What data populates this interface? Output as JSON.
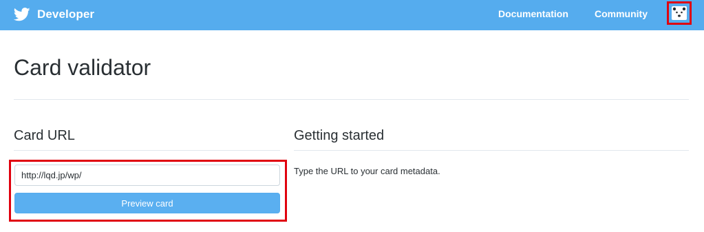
{
  "header": {
    "brand_label": "Developer",
    "brand_icon": "twitter-bird-icon",
    "nav": [
      {
        "label": "Documentation"
      },
      {
        "label": "Community"
      }
    ],
    "avatar_icon": "bear-face-icon"
  },
  "page": {
    "title": "Card validator"
  },
  "card_url": {
    "heading": "Card URL",
    "input_value": "http://lqd.jp/wp/",
    "button_label": "Preview card"
  },
  "getting_started": {
    "heading": "Getting started",
    "text": "Type the URL to your card metadata."
  },
  "colors": {
    "header_bg": "#55acee",
    "button_bg": "#5aaff0",
    "highlight": "#e0000e",
    "divider": "#e1e8ed"
  }
}
